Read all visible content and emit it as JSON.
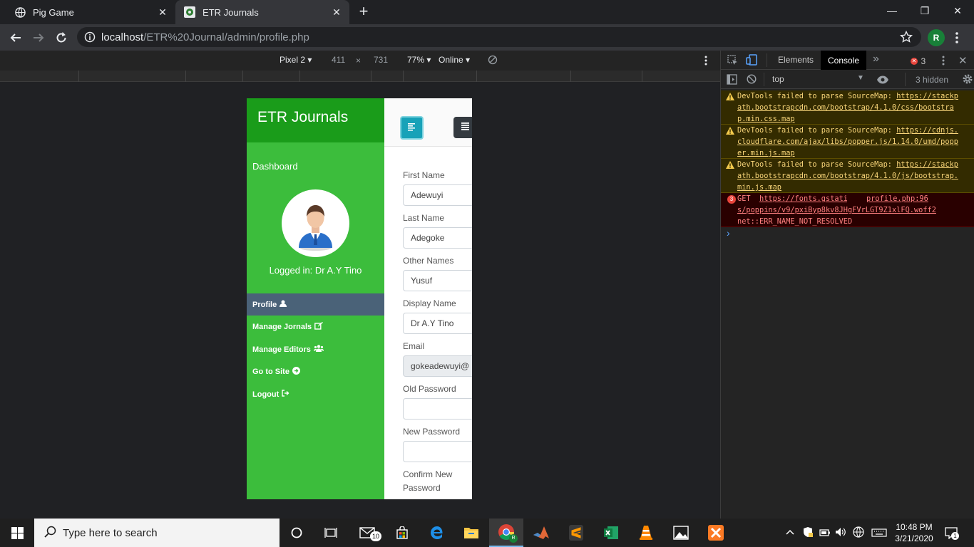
{
  "browser": {
    "tabs": [
      {
        "title": "Pig Game",
        "close": "✕"
      },
      {
        "title": "ETR Journals",
        "close": "✕"
      }
    ],
    "new_tab": "+",
    "window_controls": {
      "minimize": "—",
      "restore": "❐",
      "close": "✕"
    },
    "url_host": "localhost",
    "url_path": "/ETR%20Journal/admin/profile.php",
    "profile_initial": "R"
  },
  "device_toolbar": {
    "device": "Pixel 2",
    "width": "411",
    "times": "×",
    "height": "731",
    "zoom": "77%",
    "network": "Online"
  },
  "page": {
    "brand": "ETR Journals",
    "dashboard": "Dashboard",
    "logged_in": "Logged in: Dr A.Y Tino",
    "nav": [
      {
        "label": "Profile",
        "icon": "user-icon",
        "active": true
      },
      {
        "label": "Manage Jornals",
        "icon": "edit-icon"
      },
      {
        "label": "Manage Editors",
        "icon": "users-icon"
      },
      {
        "label": "Go to Site",
        "icon": "arrow-circle-right-icon"
      },
      {
        "label": "Logout",
        "icon": "sign-out-icon"
      }
    ],
    "form": {
      "first_name_label": "First Name",
      "first_name": "Adewuyi",
      "last_name_label": "Last Name",
      "last_name": "Adegoke",
      "other_names_label": "Other Names",
      "other_names": "Yusuf",
      "display_name_label": "Display Name",
      "display_name": "Dr A.Y Tino",
      "email_label": "Email",
      "email": "gokeadewuyi@",
      "old_password_label": "Old Password",
      "new_password_label": "New Password",
      "confirm_password_label_1": "Confirm New",
      "confirm_password_label_2": "Password"
    }
  },
  "devtools": {
    "tabs": [
      "Elements",
      "Console"
    ],
    "active_tab": "Console",
    "more": "»",
    "error_count": "3",
    "context": "top",
    "hidden": "3 hidden",
    "messages": [
      {
        "type": "warn",
        "text": "DevTools failed to parse SourceMap: ",
        "link": "https://stackpath.bootstrapcdn.com/bootstrap/4.1.0/css/bootstrap.min.css.map"
      },
      {
        "type": "warn",
        "text": "DevTools failed to parse SourceMap: ",
        "link": "https://cdnjs.cloudflare.com/ajax/libs/popper.js/1.14.0/umd/popper.min.js.map"
      },
      {
        "type": "warn",
        "text": "DevTools failed to parse SourceMap: ",
        "link": "https://stackpath.bootstrapcdn.com/bootstrap/4.1.0/js/bootstrap.min.js.map"
      },
      {
        "type": "err",
        "count": "3",
        "method": "GET",
        "link": "https://fonts.gstatic.com/s/poppins/v9/pxiByp8kv8JHgFVrLGT9Z1xlFQ.woff2",
        "source": "profile.php:96",
        "error": "net::ERR_NAME_NOT_RESOLVED"
      }
    ],
    "prompt": "›"
  },
  "taskbar": {
    "search_placeholder": "Type here to search",
    "mail_badge": "10",
    "time": "10:48 PM",
    "date": "3/21/2020",
    "notification_count": "1"
  }
}
